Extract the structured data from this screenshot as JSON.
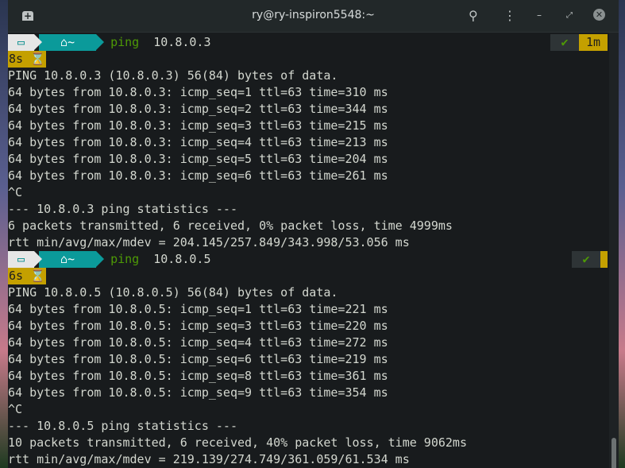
{
  "window": {
    "title": "ry@ry-inspiron5548:~"
  },
  "prompts": [
    {
      "home": "~",
      "command": "ping",
      "arg": "10.8.0.3",
      "status": "✔",
      "elapsed": "1m",
      "duration": "8s"
    },
    {
      "home": "~",
      "command": "ping",
      "arg": "10.8.0.5",
      "status": "✔",
      "elapsed": "",
      "duration": "6s"
    }
  ],
  "output1": [
    "PING 10.8.0.3 (10.8.0.3) 56(84) bytes of data.",
    "64 bytes from 10.8.0.3: icmp_seq=1 ttl=63 time=310 ms",
    "64 bytes from 10.8.0.3: icmp_seq=2 ttl=63 time=344 ms",
    "64 bytes from 10.8.0.3: icmp_seq=3 ttl=63 time=215 ms",
    "64 bytes from 10.8.0.3: icmp_seq=4 ttl=63 time=213 ms",
    "64 bytes from 10.8.0.3: icmp_seq=5 ttl=63 time=204 ms",
    "64 bytes from 10.8.0.3: icmp_seq=6 ttl=63 time=261 ms",
    "^C",
    "--- 10.8.0.3 ping statistics ---",
    "6 packets transmitted, 6 received, 0% packet loss, time 4999ms",
    "rtt min/avg/max/mdev = 204.145/257.849/343.998/53.056 ms"
  ],
  "output2": [
    "PING 10.8.0.5 (10.8.0.5) 56(84) bytes of data.",
    "64 bytes from 10.8.0.5: icmp_seq=1 ttl=63 time=221 ms",
    "64 bytes from 10.8.0.5: icmp_seq=3 ttl=63 time=220 ms",
    "64 bytes from 10.8.0.5: icmp_seq=4 ttl=63 time=272 ms",
    "64 bytes from 10.8.0.5: icmp_seq=6 ttl=63 time=219 ms",
    "64 bytes from 10.8.0.5: icmp_seq=8 ttl=63 time=361 ms",
    "64 bytes from 10.8.0.5: icmp_seq=9 ttl=63 time=354 ms",
    "^C",
    "--- 10.8.0.5 ping statistics ---",
    "10 packets transmitted, 6 received, 40% packet loss, time 9062ms",
    "rtt min/avg/max/mdev = 219.139/274.749/361.059/61.534 ms"
  ]
}
